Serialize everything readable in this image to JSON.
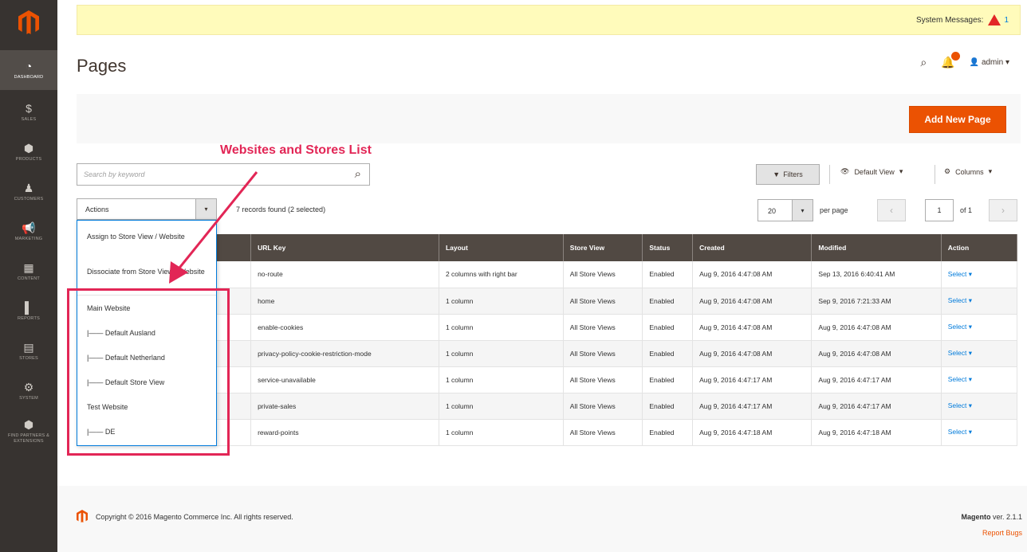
{
  "sidebar": {
    "items": [
      {
        "label": "DASHBOARD",
        "icon": "dashboard-icon",
        "glyph": "◔"
      },
      {
        "label": "SALES",
        "icon": "dollar-icon",
        "glyph": "$"
      },
      {
        "label": "PRODUCTS",
        "icon": "cube-icon",
        "glyph": "⬢"
      },
      {
        "label": "CUSTOMERS",
        "icon": "person-icon",
        "glyph": "♟"
      },
      {
        "label": "MARKETING",
        "icon": "megaphone-icon",
        "glyph": "📢"
      },
      {
        "label": "CONTENT",
        "icon": "layout-icon",
        "glyph": "▦"
      },
      {
        "label": "REPORTS",
        "icon": "bar-chart-icon",
        "glyph": "▌"
      },
      {
        "label": "STORES",
        "icon": "store-icon",
        "glyph": "▤"
      },
      {
        "label": "SYSTEM",
        "icon": "gear-icon",
        "glyph": "⚙"
      },
      {
        "label": "FIND PARTNERS & EXTENSIONS",
        "icon": "puzzle-icon",
        "glyph": "⬢"
      }
    ]
  },
  "notice": {
    "label": "System Messages:",
    "count": "1"
  },
  "header": {
    "title": "Pages",
    "user": "admin"
  },
  "toolbar": {
    "add_label": "Add New Page",
    "search_placeholder": "Search by keyword",
    "filters_label": "Filters",
    "view_label": "Default View",
    "columns_label": "Columns",
    "actions_label": "Actions",
    "records_text": "7 records found (2 selected)",
    "per_page_value": "20",
    "per_page_label": "per page",
    "page_value": "1",
    "page_of": "of 1"
  },
  "annotation": {
    "title": "Websites and Stores List"
  },
  "dropdown": {
    "items": [
      "Assign to Store View / Website",
      "Dissociate from Store View / Website",
      "Main Website",
      "|—— Default Ausland",
      "|—— Default Netherland",
      "|—— Default Store View",
      "Test Website",
      "|—— DE"
    ]
  },
  "table": {
    "columns": [
      "",
      "URL Key",
      "Layout",
      "Store View",
      "Status",
      "Created",
      "Modified",
      "Action"
    ],
    "rows": [
      {
        "title": "",
        "url": "no-route",
        "layout": "2 columns with right bar",
        "store": "All Store Views",
        "status": "Enabled",
        "created": "Aug 9, 2016 4:47:08 AM",
        "modified": "Sep 13, 2016 6:40:41 AM",
        "action": "Select ▾"
      },
      {
        "title": "",
        "url": "home",
        "layout": "1 column",
        "store": "All Store Views",
        "status": "Enabled",
        "created": "Aug 9, 2016 4:47:08 AM",
        "modified": "Sep 9, 2016 7:21:33 AM",
        "action": "Select ▾"
      },
      {
        "title": "",
        "url": "enable-cookies",
        "layout": "1 column",
        "store": "All Store Views",
        "status": "Enabled",
        "created": "Aug 9, 2016 4:47:08 AM",
        "modified": "Aug 9, 2016 4:47:08 AM",
        "action": "Select ▾"
      },
      {
        "title": "ie Policy",
        "url": "privacy-policy-cookie-restriction-mode",
        "layout": "1 column",
        "store": "All Store Views",
        "status": "Enabled",
        "created": "Aug 9, 2016 4:47:08 AM",
        "modified": "Aug 9, 2016 4:47:08 AM",
        "action": "Select ▾"
      },
      {
        "title": "able",
        "url": "service-unavailable",
        "layout": "1 column",
        "store": "All Store Views",
        "status": "Enabled",
        "created": "Aug 9, 2016 4:47:17 AM",
        "modified": "Aug 9, 2016 4:47:17 AM",
        "action": "Select ▾"
      },
      {
        "title": "lusive Online Store",
        "url": "private-sales",
        "layout": "1 column",
        "store": "All Store Views",
        "status": "Enabled",
        "created": "Aug 9, 2016 4:47:17 AM",
        "modified": "Aug 9, 2016 4:47:17 AM",
        "action": "Select ▾"
      },
      {
        "title": "",
        "url": "reward-points",
        "layout": "1 column",
        "store": "All Store Views",
        "status": "Enabled",
        "created": "Aug 9, 2016 4:47:18 AM",
        "modified": "Aug 9, 2016 4:47:18 AM",
        "action": "Select ▾"
      }
    ]
  },
  "footer": {
    "copyright": "Copyright © 2016 Magento Commerce Inc. All rights reserved.",
    "brand": "Magento",
    "version": "ver. 2.1.1",
    "report": "Report Bugs"
  },
  "colors": {
    "accent": "#eb5202",
    "annotation": "#e22656",
    "sidebar": "#373330",
    "header_row": "#514943"
  }
}
